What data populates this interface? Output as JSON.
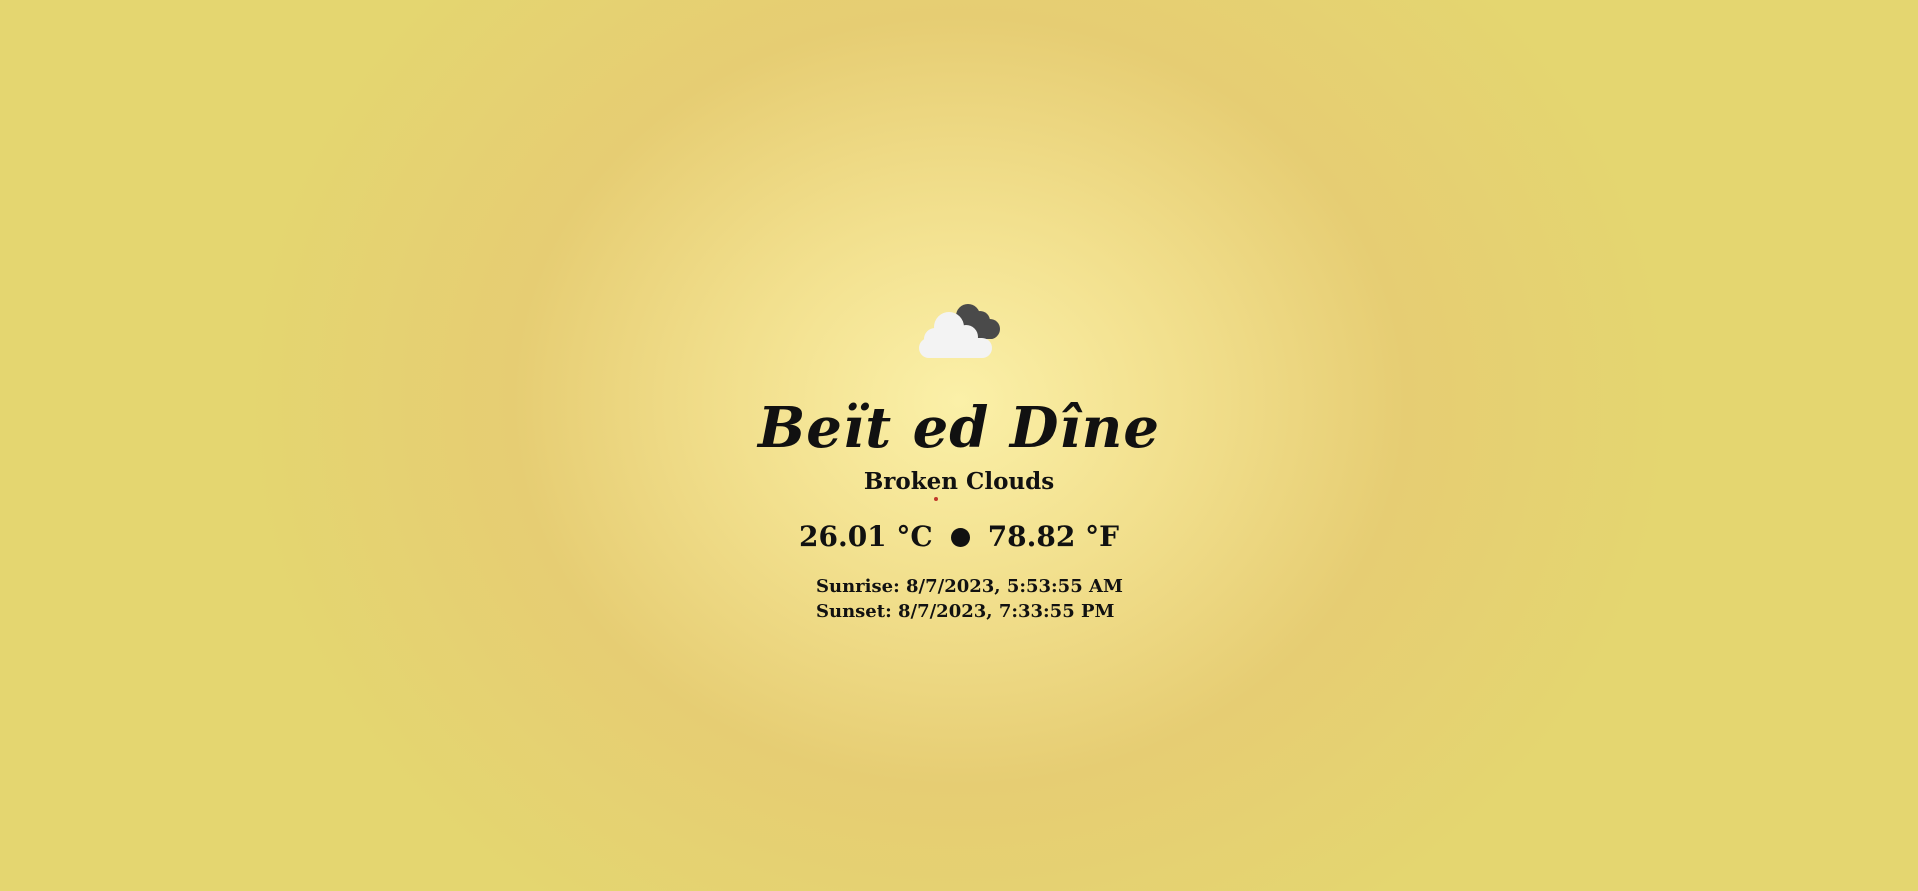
{
  "weather": {
    "icon": "broken-clouds-icon",
    "city": "Beït ed Dîne",
    "condition": "Broken Clouds",
    "temp_c": "26.01 °C",
    "temp_f": "78.82 °F",
    "sunrise": "Sunrise: 8/7/2023, 5:53:55 AM",
    "sunset": "Sunset: 8/7/2023, 7:33:55 PM"
  },
  "colors": {
    "background_center": "#fbf0a8",
    "background_edge": "#e4d670",
    "text": "#111111",
    "cloud_front": "#f3f3f3",
    "cloud_back": "#4a4a4a",
    "accent_dot": "#c0392b"
  }
}
